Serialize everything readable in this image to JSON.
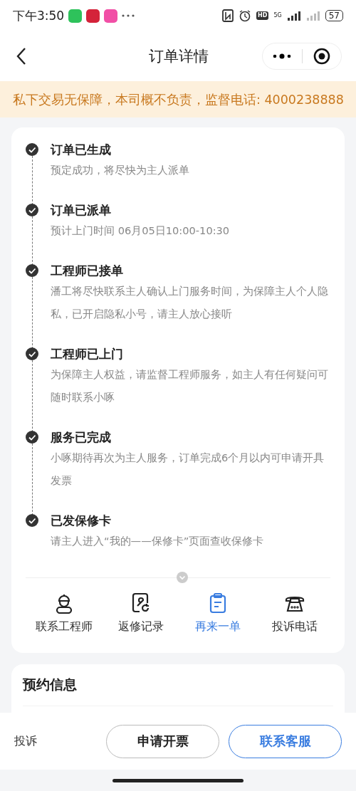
{
  "status_bar": {
    "time": "下午3:50",
    "hd_badge": "HD",
    "network": "5G",
    "battery": "57"
  },
  "header": {
    "title": "订单详情"
  },
  "notice": "私下交易无保障，本司概不负责，监督电话: 4000238888",
  "timeline": [
    {
      "title": "订单已生成",
      "description": "预定成功，将尽快为主人派单",
      "done": true
    },
    {
      "title": "订单已派单",
      "description": "预计上门时间 06月05日10:00-10:30",
      "done": true
    },
    {
      "title": "工程师已接单",
      "description": "潘工将尽快联系主人确认上门服务时间，为保障主人个人隐私，已开启隐私小号，请主人放心接听",
      "done": true
    },
    {
      "title": "工程师已上门",
      "description": "为保障主人权益，请监督工程师服务，如主人有任何疑问可随时联系小啄",
      "done": true
    },
    {
      "title": "服务已完成",
      "description": "小啄期待再次为主人服务，订单完成6个月以内可申请开具发票",
      "done": true
    },
    {
      "title": "已发保修卡",
      "description": "请主人进入“我的——保修卡”页面查收保修卡",
      "done": true
    }
  ],
  "actions": [
    {
      "kind": "engineer",
      "label": "联系工程师",
      "selected": false
    },
    {
      "kind": "repair",
      "label": "返修记录",
      "selected": false
    },
    {
      "kind": "clipboard",
      "label": "再来一单",
      "selected": true
    },
    {
      "kind": "phone",
      "label": "投诉电话",
      "selected": false
    }
  ],
  "booking": {
    "title": "预约信息"
  },
  "bottom_bar": {
    "complaint": "投诉",
    "invoice_button": "申请开票",
    "service_button": "联系客服"
  }
}
